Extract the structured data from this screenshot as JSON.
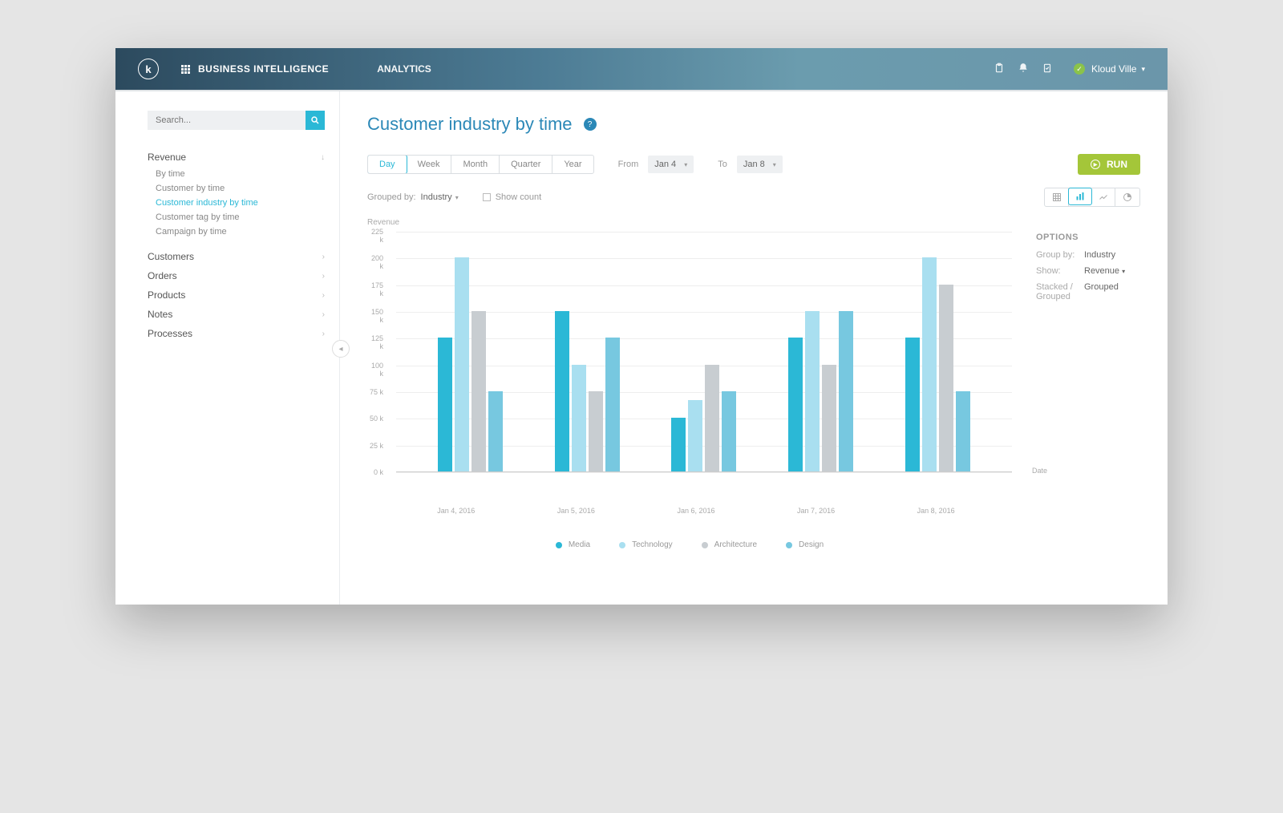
{
  "header": {
    "app_name": "BUSINESS INTELLIGENCE",
    "nav_item": "ANALYTICS",
    "user_name": "Kloud Ville"
  },
  "sidebar": {
    "search_placeholder": "Search...",
    "categories": [
      {
        "label": "Revenue",
        "expanded": true,
        "items": [
          {
            "label": "By time"
          },
          {
            "label": "Customer by time"
          },
          {
            "label": "Customer industry by time",
            "active": true
          },
          {
            "label": "Customer tag by time"
          },
          {
            "label": "Campaign by time"
          }
        ]
      },
      {
        "label": "Customers"
      },
      {
        "label": "Orders"
      },
      {
        "label": "Products"
      },
      {
        "label": "Notes"
      },
      {
        "label": "Processes"
      }
    ]
  },
  "page": {
    "title": "Customer industry by time",
    "periods": [
      "Day",
      "Week",
      "Month",
      "Quarter",
      "Year"
    ],
    "active_period": "Day",
    "from_label": "From",
    "to_label": "To",
    "from_value": "Jan 4",
    "to_value": "Jan 8",
    "run_label": "RUN",
    "grouped_by_label": "Grouped by:",
    "grouped_by_value": "Industry",
    "show_count_label": "Show count",
    "options_title": "OPTIONS",
    "options": [
      {
        "k": "Group by:",
        "v": "Industry"
      },
      {
        "k": "Show:",
        "v": "Revenue",
        "drop": true
      },
      {
        "k": "Stacked / Grouped",
        "v": "Grouped"
      }
    ]
  },
  "chart_data": {
    "type": "bar",
    "title": "",
    "ylabel": "Revenue",
    "xlabel": "Date",
    "ylim": [
      0,
      225
    ],
    "y_ticks": [
      0,
      25,
      50,
      75,
      100,
      125,
      150,
      175,
      200,
      225
    ],
    "y_tick_suffix": " k",
    "categories": [
      "Jan 4, 2016",
      "Jan 5, 2016",
      "Jan 6, 2016",
      "Jan 7, 2016",
      "Jan 8, 2016"
    ],
    "series": [
      {
        "name": "Media",
        "color": "#2bb8d6",
        "values": [
          125,
          150,
          50,
          125,
          125
        ]
      },
      {
        "name": "Technology",
        "color": "#a9dff0",
        "values": [
          200,
          100,
          67,
          150,
          200
        ]
      },
      {
        "name": "Architecture",
        "color": "#c8cdd1",
        "values": [
          150,
          75,
          100,
          100,
          175
        ]
      },
      {
        "name": "Design",
        "color": "#77c8e0",
        "values": [
          75,
          125,
          75,
          150,
          75
        ]
      }
    ]
  }
}
